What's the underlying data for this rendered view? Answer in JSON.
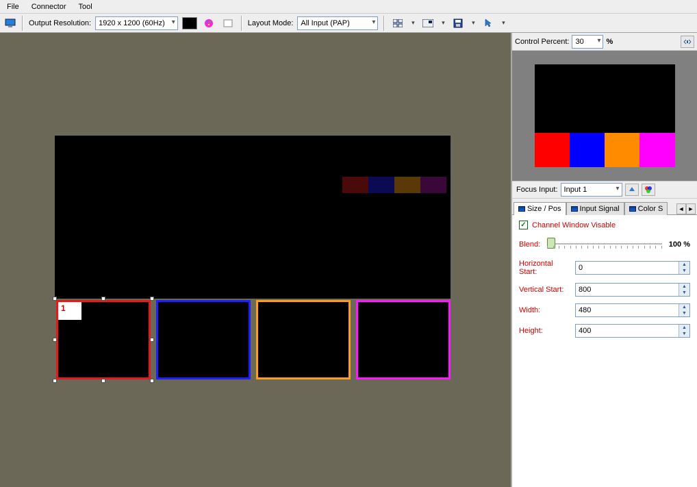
{
  "menu": {
    "file": "File",
    "connector": "Connector",
    "tool": "Tool"
  },
  "toolbar": {
    "output_res_label": "Output Resolution:",
    "output_res_value": "1920 x 1200 (60Hz)",
    "layout_mode_label": "Layout Mode:",
    "layout_mode_value": "All Input (PAP)"
  },
  "side": {
    "control_percent_label": "Control Percent:",
    "control_percent_value": "30",
    "percent_sign": "%",
    "focus_input_label": "Focus Input:",
    "focus_input_value": "Input 1",
    "tabs": {
      "size_pos": "Size / Pos",
      "input_signal": "Input Signal",
      "color": "Color S"
    },
    "chk_label": "Channel Window Visable",
    "blend_label": "Blend:",
    "blend_value": "100 %",
    "h_start_label": "Horizontal Start:",
    "h_start_value": "0",
    "v_start_label": "Vertical Start:",
    "v_start_value": "800",
    "width_label": "Width:",
    "width_value": "480",
    "height_label": "Height:",
    "height_value": "400"
  },
  "canvas": {
    "tile1_label": "1"
  }
}
